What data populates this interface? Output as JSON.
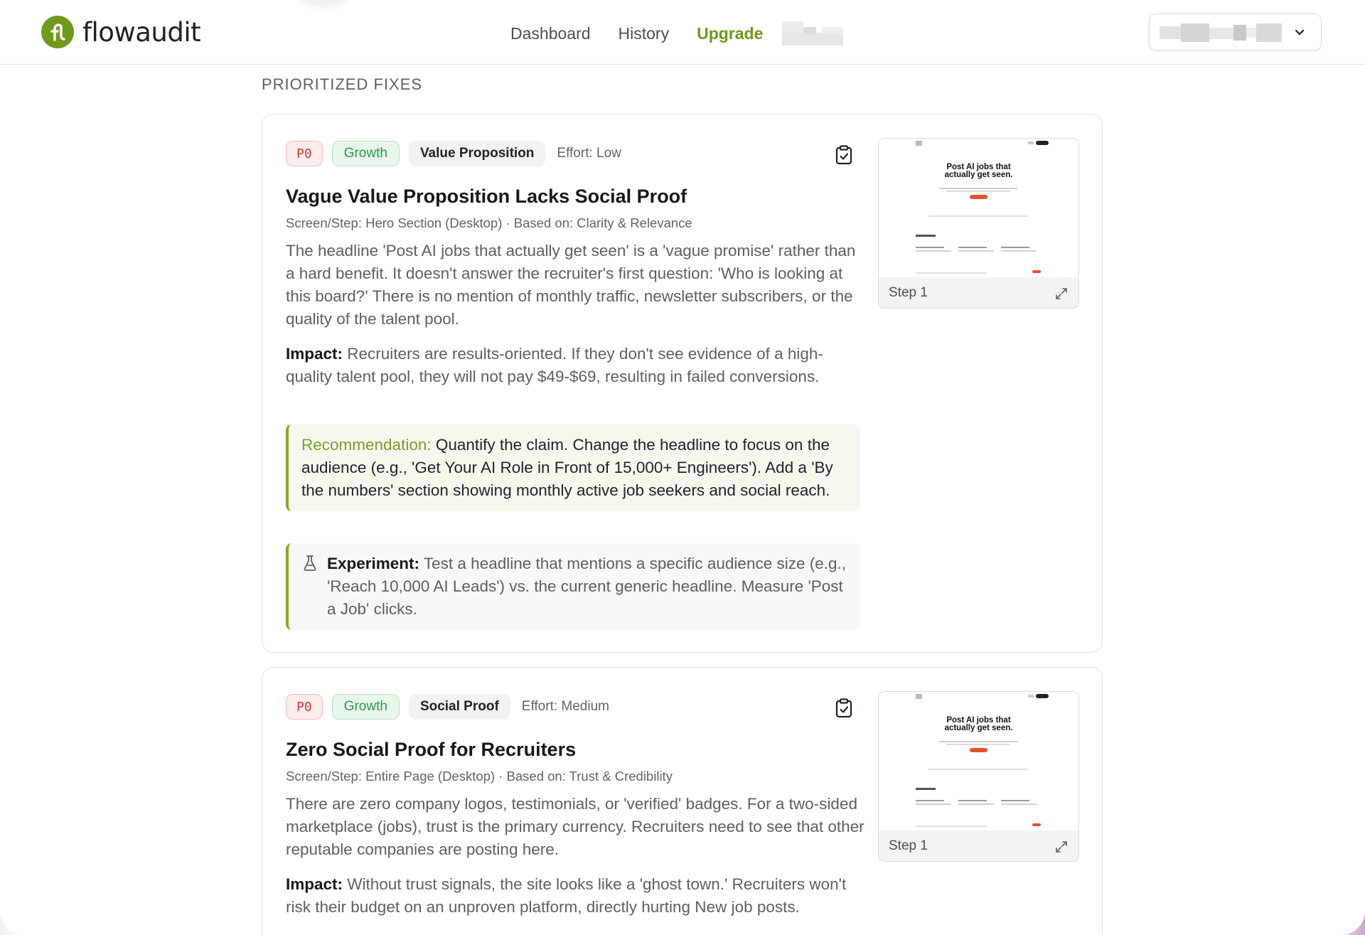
{
  "nav": {
    "brand": "flowaudit",
    "links": [
      {
        "label": "Dashboard"
      },
      {
        "label": "History"
      },
      {
        "label": "Upgrade"
      }
    ],
    "brand_color": "#6f9a1d"
  },
  "section": {
    "title": "PRIORITIZED FIXES"
  },
  "fixes": [
    {
      "priority": "P0",
      "team": "Growth",
      "category": "Value Proposition",
      "effort": "Effort: Low",
      "title": "Vague Value Proposition Lacks Social Proof",
      "meta": "Screen/Step: Hero Section (Desktop) · Based on: Clarity & Relevance",
      "description": "The headline 'Post AI jobs that actually get seen' is a 'vague promise' rather than a hard benefit. It doesn't answer the recruiter's first question: 'Who is looking at this board?' There is no mention of monthly traffic, newsletter subscribers, or the quality of the talent pool.",
      "impact_label": "Impact:",
      "impact": "Recruiters are results-oriented. If they don't see evidence of a high-quality talent pool, they will not pay $49-$69, resulting in failed conversions.",
      "recommendation_label": "Recommendation:",
      "recommendation": "Quantify the claim. Change the headline to focus on the audience (e.g., 'Get Your AI Role in Front of 15,000+ Engineers'). Add a 'By the numbers' section showing monthly active job seekers and social reach.",
      "experiment_label": "Experiment:",
      "experiment": "Test a headline that mentions a specific audience size (e.g., 'Reach 10,000 AI Leads') vs. the current generic headline. Measure 'Post a Job' clicks.",
      "thumb": {
        "headline_1": "Post AI jobs that",
        "headline_2": "actually get seen.",
        "label": "Step 1"
      }
    },
    {
      "priority": "P0",
      "team": "Growth",
      "category": "Social Proof",
      "effort": "Effort: Medium",
      "title": "Zero Social Proof for Recruiters",
      "meta": "Screen/Step: Entire Page (Desktop) · Based on: Trust & Credibility",
      "description": "There are zero company logos, testimonials, or 'verified' badges. For a two-sided marketplace (jobs), trust is the primary currency. Recruiters need to see that other reputable companies are posting here.",
      "impact_label": "Impact:",
      "impact": "Without trust signals, the site looks like a 'ghost town.' Recruiters won't risk their budget on an unproven platform, directly hurting New job posts.",
      "thumb": {
        "headline_1": "Post AI jobs that",
        "headline_2": "actually get seen.",
        "label": "Step 1"
      }
    }
  ]
}
